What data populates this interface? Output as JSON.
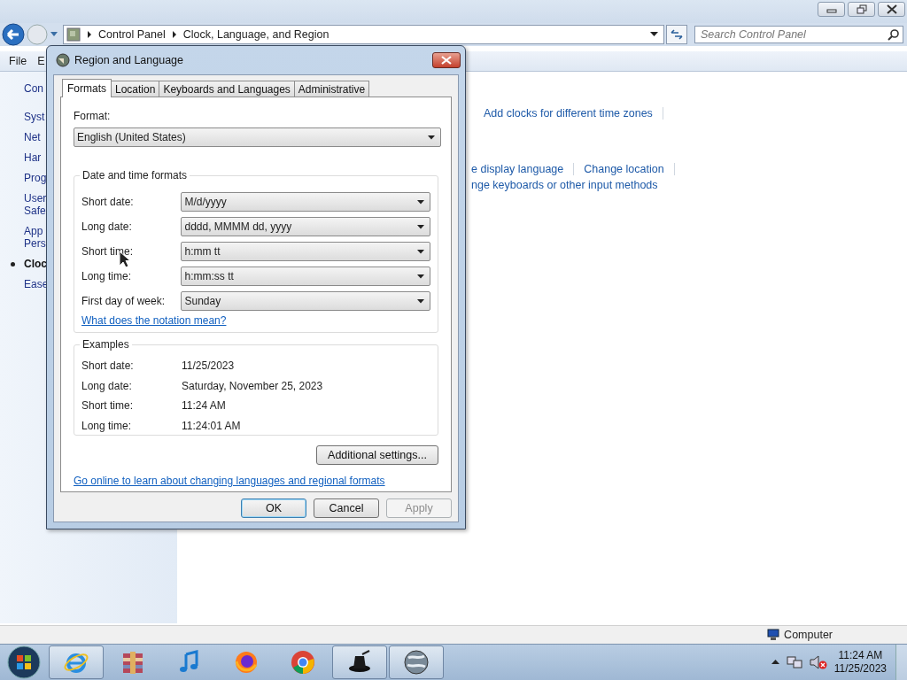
{
  "explorer": {
    "breadcrumb": [
      "Control Panel",
      "Clock, Language, and Region"
    ],
    "search": {
      "placeholder": "Search Control Panel"
    },
    "menu": [
      "File",
      "E"
    ],
    "sidebar": [
      {
        "lines": [
          "Con"
        ],
        "selected": false
      },
      {
        "lines": [
          "Syst"
        ],
        "selected": false
      },
      {
        "lines": [
          "Net"
        ],
        "selected": false
      },
      {
        "lines": [
          "Har"
        ],
        "selected": false
      },
      {
        "lines": [
          "Prog"
        ],
        "selected": false
      },
      {
        "lines": [
          "User",
          "Safe"
        ],
        "selected": false
      },
      {
        "lines": [
          "App",
          "Pers"
        ],
        "selected": false
      },
      {
        "lines": [
          "Cloc"
        ],
        "selected": true
      },
      {
        "lines": [
          "Ease"
        ],
        "selected": false
      }
    ],
    "link_rows": [
      [
        "Add clocks for different time zones"
      ],
      [
        "e display language",
        "Change location"
      ],
      [
        "nge keyboards or other input methods"
      ]
    ],
    "status": "Computer"
  },
  "dialog": {
    "title": "Region and Language",
    "tabs": [
      {
        "label": "Formats",
        "selected": true
      },
      {
        "label": "Location",
        "selected": false
      },
      {
        "label": "Keyboards and Languages",
        "selected": false
      },
      {
        "label": "Administrative",
        "selected": false
      }
    ],
    "format": {
      "label": "Format:",
      "value": "English (United States)"
    },
    "formats_group": {
      "title": "Date and time formats",
      "rows": [
        {
          "label": "Short date:",
          "value": "M/d/yyyy"
        },
        {
          "label": "Long date:",
          "value": "dddd, MMMM dd, yyyy"
        },
        {
          "label": "Short time:",
          "value": "h:mm tt"
        },
        {
          "label": "Long time:",
          "value": "h:mm:ss tt"
        },
        {
          "label": "First day of week:",
          "value": "Sunday"
        }
      ],
      "link": "What does the notation mean?"
    },
    "examples": {
      "title": "Examples",
      "rows": [
        {
          "label": "Short date:",
          "value": "11/25/2023"
        },
        {
          "label": "Long date:",
          "value": "Saturday, November 25, 2023"
        },
        {
          "label": "Short time:",
          "value": "11:24 AM"
        },
        {
          "label": "Long time:",
          "value": "11:24:01 AM"
        }
      ]
    },
    "additional_button": "Additional settings...",
    "online_link": "Go online to learn about changing languages and regional formats",
    "buttons": [
      {
        "label": "OK",
        "default": true,
        "disabled": false
      },
      {
        "label": "Cancel",
        "default": false,
        "disabled": false
      },
      {
        "label": "Apply",
        "default": false,
        "disabled": true
      }
    ]
  },
  "taskbar": {
    "apps": [
      {
        "kind": "ie",
        "running": true
      },
      {
        "kind": "archive",
        "running": false
      },
      {
        "kind": "music",
        "running": false
      },
      {
        "kind": "firefox",
        "running": false
      },
      {
        "kind": "chrome",
        "running": false
      },
      {
        "kind": "hat",
        "running": true
      },
      {
        "kind": "globe",
        "running": true
      }
    ],
    "time": "11:24 AM",
    "date": "11/25/2023"
  }
}
